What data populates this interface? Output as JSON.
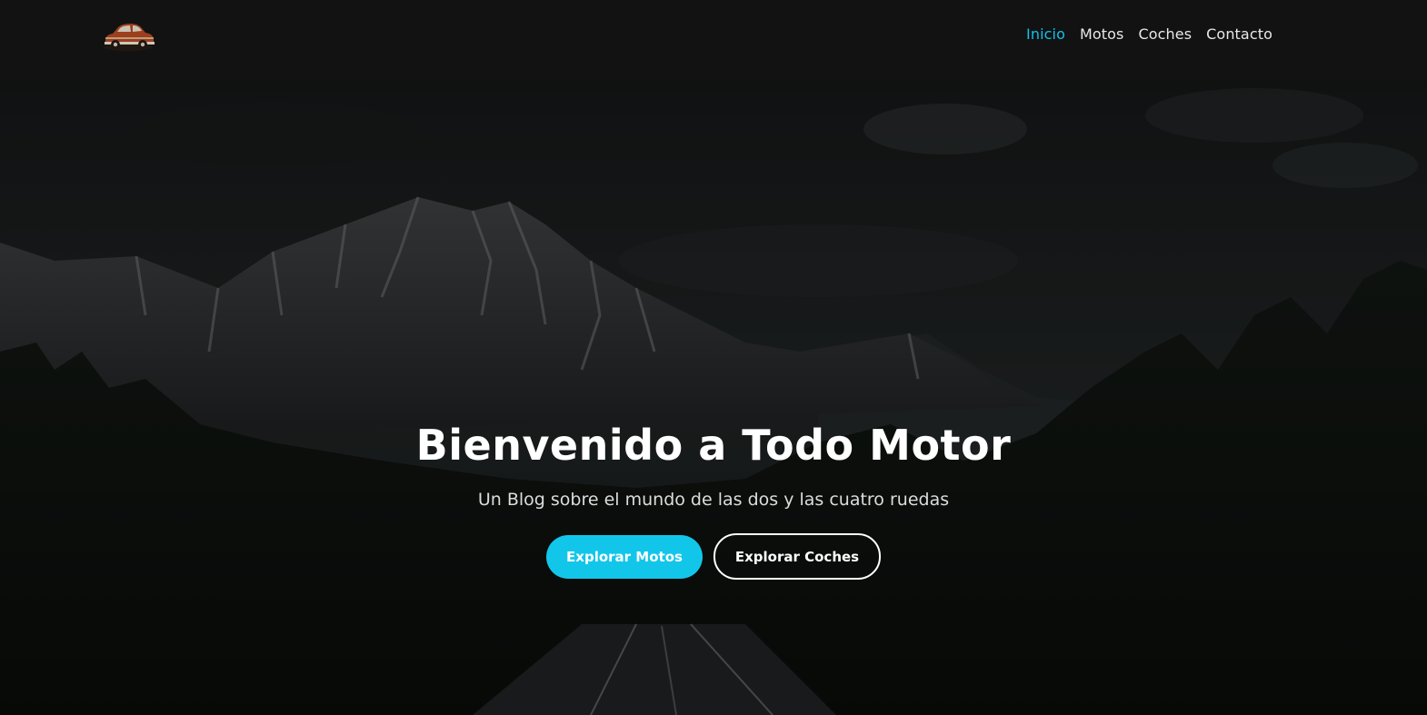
{
  "nav": {
    "logo_icon": "vintage-car-icon",
    "links": [
      {
        "label": "Inicio",
        "active": true
      },
      {
        "label": "Motos",
        "active": false
      },
      {
        "label": "Coches",
        "active": false
      },
      {
        "label": "Contacto",
        "active": false
      }
    ]
  },
  "hero": {
    "title": "Bienvenido a Todo Motor",
    "subtitle": "Un Blog sobre el mundo de las dos y las cuatro ruedas",
    "primary_button": "Explorar Motos",
    "secondary_button": "Explorar Coches",
    "background": "mountain-road-photo"
  },
  "colors": {
    "accent": "#12c6ea",
    "active_link": "#12c0e8",
    "navbar_bg": "#121212",
    "text": "#ffffff"
  }
}
